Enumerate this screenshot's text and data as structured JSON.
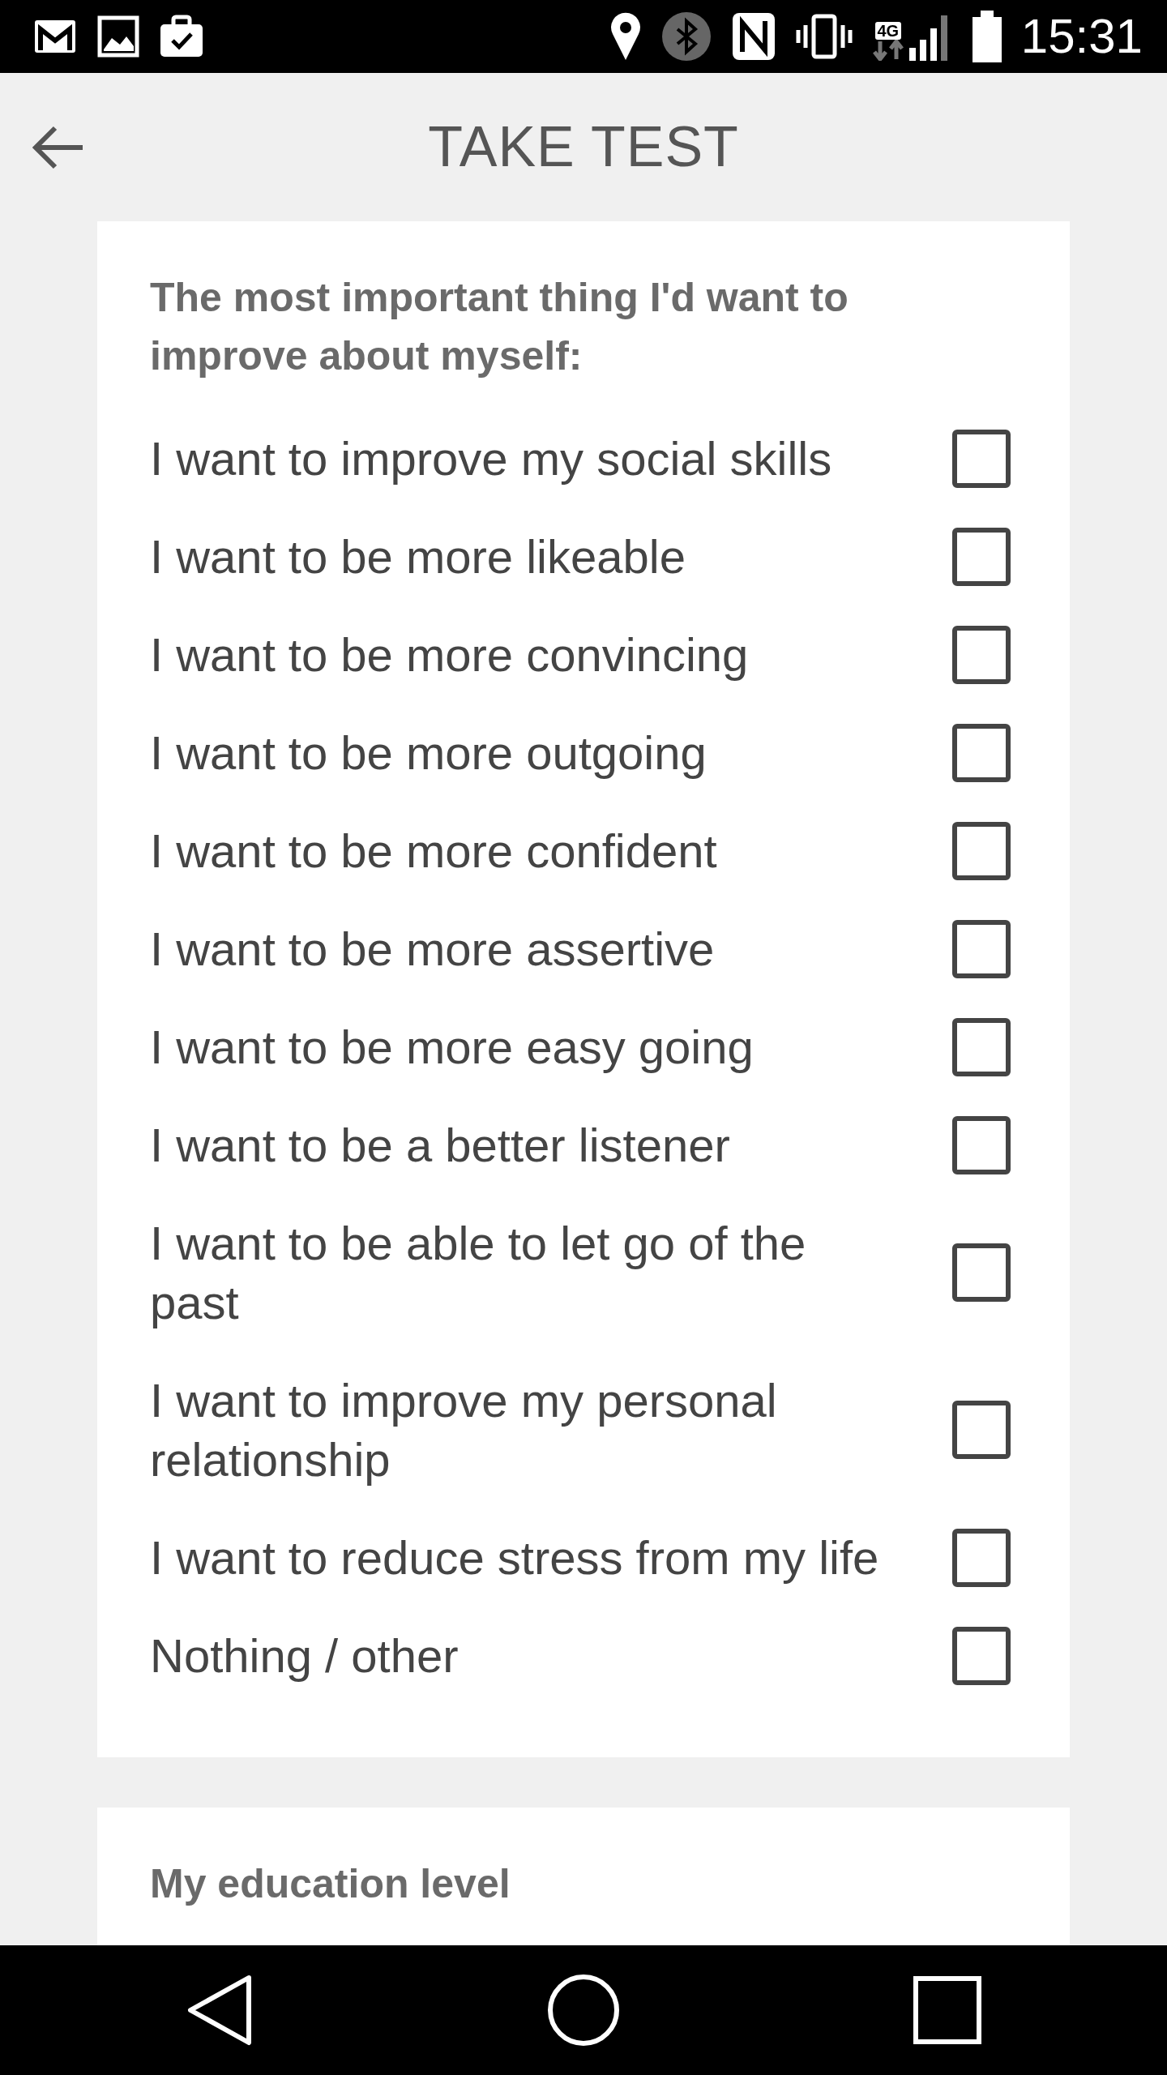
{
  "status_bar": {
    "time": "15:31",
    "network": "4G"
  },
  "header": {
    "title": "TAKE TEST"
  },
  "questions": [
    {
      "title": "The most important thing I'd want to improve about myself:",
      "options": [
        {
          "label": "I want to improve my social skills",
          "checked": false
        },
        {
          "label": "I want to be more likeable",
          "checked": false
        },
        {
          "label": "I want to be more convincing",
          "checked": false
        },
        {
          "label": "I want to be more outgoing",
          "checked": false
        },
        {
          "label": "I want to be more confident",
          "checked": false
        },
        {
          "label": "I want to be more assertive",
          "checked": false
        },
        {
          "label": "I want to be more easy going",
          "checked": false
        },
        {
          "label": "I want to be a better listener",
          "checked": false
        },
        {
          "label": "I want to be able to let go of the past",
          "checked": false
        },
        {
          "label": "I want to improve my personal relationship",
          "checked": false
        },
        {
          "label": "I want to reduce stress from my life",
          "checked": false
        },
        {
          "label": "Nothing / other",
          "checked": false
        }
      ]
    },
    {
      "title": "My education level"
    }
  ]
}
